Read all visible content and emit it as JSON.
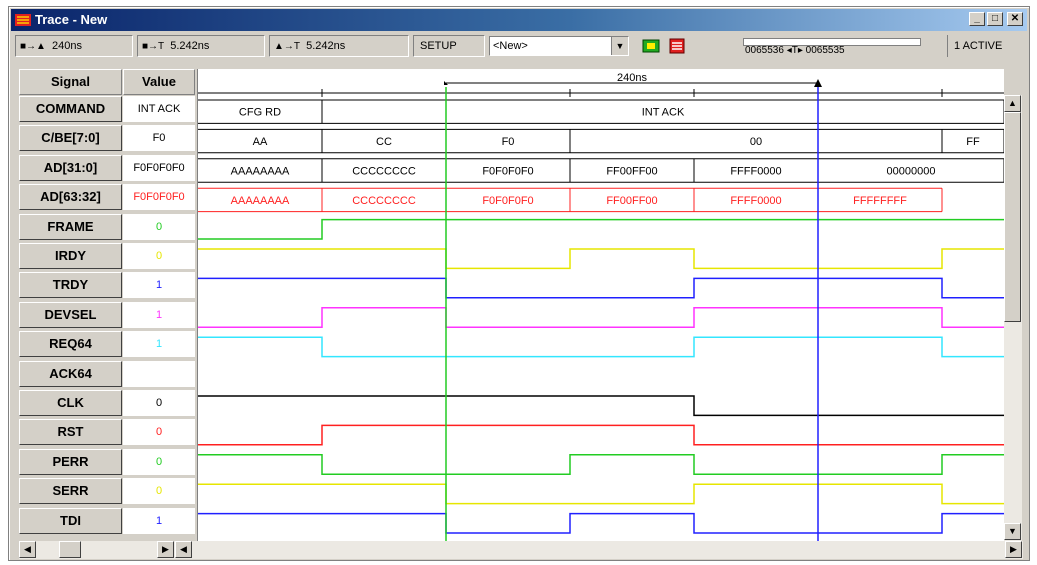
{
  "window": {
    "title": "Trace - New",
    "controls": [
      "_",
      "□",
      "✕"
    ]
  },
  "toolbar": {
    "marker1": {
      "icon": "■→▲",
      "value": "240ns"
    },
    "marker2": {
      "icon": "■→T",
      "value": "5.242ns"
    },
    "marker3": {
      "icon": "▲→T",
      "value": "5.242ns"
    },
    "setup_label": "SETUP",
    "dropdown_value": "<New>",
    "counter_text": "0065536  ◂T▸ 0065535",
    "active_text": "1  ACTIVE"
  },
  "grid": {
    "signal_header": "Signal",
    "value_header": "Value",
    "ruler_label": "240ns",
    "rows": [
      {
        "name": "COMMAND",
        "value": "INT ACK",
        "color": "#000000"
      },
      {
        "name": "C/BE[7:0]",
        "value": "F0",
        "color": "#000000"
      },
      {
        "name": "AD[31:0]",
        "value": "F0F0F0F0",
        "color": "#000000"
      },
      {
        "name": "AD[63:32]",
        "value": "F0F0F0F0",
        "color": "#ff2020"
      },
      {
        "name": "FRAME",
        "value": "0",
        "color": "#22cc22"
      },
      {
        "name": "IRDY",
        "value": "0",
        "color": "#e6e600"
      },
      {
        "name": "TRDY",
        "value": "1",
        "color": "#2020ff"
      },
      {
        "name": "DEVSEL",
        "value": "1",
        "color": "#ff33ff"
      },
      {
        "name": "REQ64",
        "value": "1",
        "color": "#33e6ff"
      },
      {
        "name": "ACK64",
        "value": "",
        "color": "#000000"
      },
      {
        "name": "CLK",
        "value": "0",
        "color": "#000000"
      },
      {
        "name": "RST",
        "value": "0",
        "color": "#ff2020"
      },
      {
        "name": "PERR",
        "value": "0",
        "color": "#22cc22"
      },
      {
        "name": "SERR",
        "value": "0",
        "color": "#e6e600"
      },
      {
        "name": "TDI",
        "value": "1",
        "color": "#2020ff"
      }
    ],
    "bus_segments": {
      "COMMAND": [
        "CFG RD",
        "INT ACK"
      ],
      "C/BE[7:0]": [
        "AA",
        "CC",
        "F0",
        "00",
        "FF"
      ],
      "AD[31:0]": [
        "AAAAAAAA",
        "CCCCCCCC",
        "F0F0F0F0",
        "FF00FF00",
        "FFFF0000",
        "00000000"
      ],
      "AD[63:32]": [
        "AAAAAAAA",
        "CCCCCCCC",
        "F0F0F0F0",
        "FF00FF00",
        "FFFF0000",
        "FFFFFFFF"
      ]
    }
  }
}
